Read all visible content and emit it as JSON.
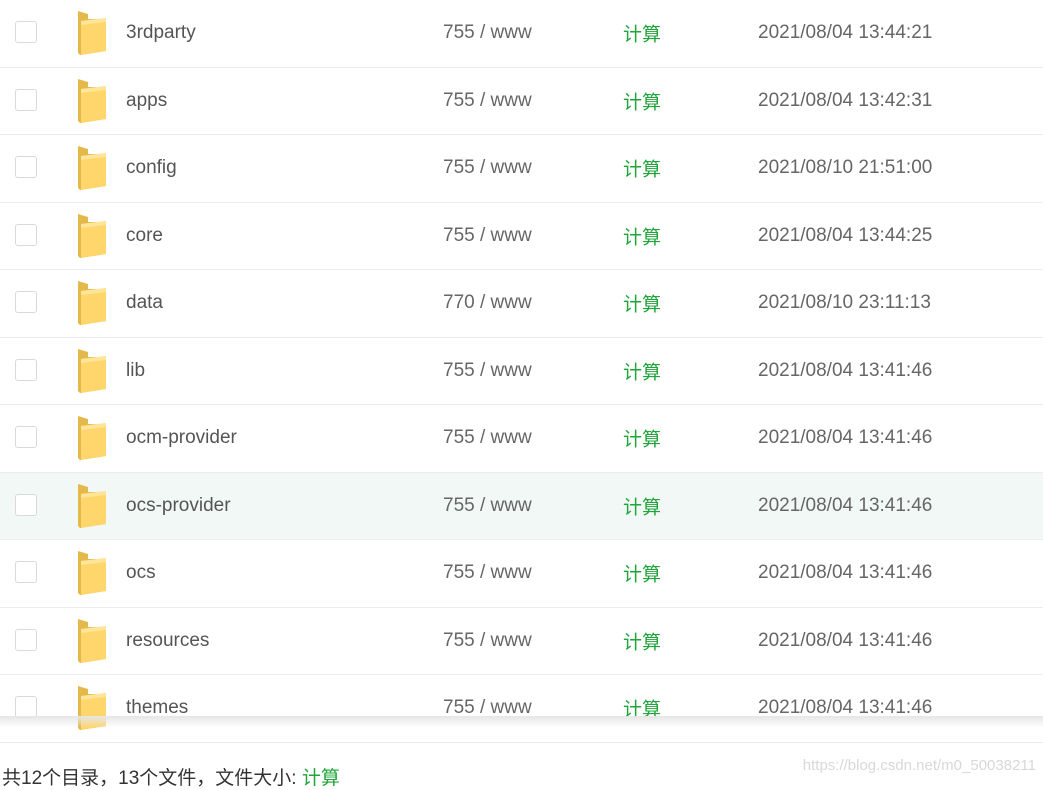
{
  "rows": [
    {
      "name": "3rdparty",
      "perm": "755 / www",
      "size_action": "计算",
      "modified": "2021/08/04 13:44:21"
    },
    {
      "name": "apps",
      "perm": "755 / www",
      "size_action": "计算",
      "modified": "2021/08/04 13:42:31"
    },
    {
      "name": "config",
      "perm": "755 / www",
      "size_action": "计算",
      "modified": "2021/08/10 21:51:00"
    },
    {
      "name": "core",
      "perm": "755 / www",
      "size_action": "计算",
      "modified": "2021/08/04 13:44:25"
    },
    {
      "name": "data",
      "perm": "770 / www",
      "size_action": "计算",
      "modified": "2021/08/10 23:11:13"
    },
    {
      "name": "lib",
      "perm": "755 / www",
      "size_action": "计算",
      "modified": "2021/08/04 13:41:46"
    },
    {
      "name": "ocm-provider",
      "perm": "755 / www",
      "size_action": "计算",
      "modified": "2021/08/04 13:41:46"
    },
    {
      "name": "ocs-provider",
      "perm": "755 / www",
      "size_action": "计算",
      "modified": "2021/08/04 13:41:46"
    },
    {
      "name": "ocs",
      "perm": "755 / www",
      "size_action": "计算",
      "modified": "2021/08/04 13:41:46"
    },
    {
      "name": "resources",
      "perm": "755 / www",
      "size_action": "计算",
      "modified": "2021/08/04 13:41:46"
    },
    {
      "name": "themes",
      "perm": "755 / www",
      "size_action": "计算",
      "modified": "2021/08/04 13:41:46"
    }
  ],
  "highlight_index": 7,
  "footer": {
    "summary": "共12个目录，13个文件，文件大小: ",
    "calc_label": "计算"
  },
  "watermark": "https://blog.csdn.net/m0_50038211",
  "colors": {
    "accent": "#20a53a",
    "folder": "#ffd66b",
    "row_highlight": "#f1f8f6"
  },
  "icons": {
    "folder": "folder-icon",
    "checkbox": "checkbox"
  }
}
